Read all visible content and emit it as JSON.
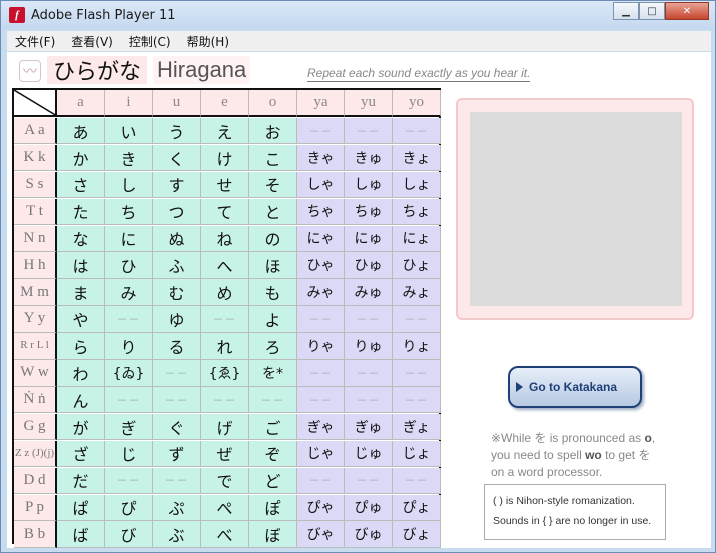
{
  "window": {
    "title": "Adobe Flash Player 11",
    "controls": [
      "minimize",
      "maximize",
      "close"
    ]
  },
  "menubar": {
    "items": [
      "文件(F)",
      "查看(V)",
      "控制(C)",
      "帮助(H)"
    ]
  },
  "header": {
    "hiragana_title": "ひらがな",
    "romaji_title": "Hiragana",
    "instruction": "Repeat each sound exactly as you hear it."
  },
  "table": {
    "columns": [
      "a",
      "i",
      "u",
      "e",
      "o",
      "ya",
      "yu",
      "yo"
    ],
    "rows": [
      {
        "label": "A a",
        "cells": [
          "あ",
          "い",
          "う",
          "え",
          "お",
          "－－",
          "－－",
          "－－"
        ]
      },
      {
        "label": "K k",
        "cells": [
          "か",
          "き",
          "く",
          "け",
          "こ",
          "きゃ",
          "きゅ",
          "きょ"
        ]
      },
      {
        "label": "S s",
        "cells": [
          "さ",
          "し",
          "す",
          "せ",
          "そ",
          "しゃ",
          "しゅ",
          "しょ"
        ]
      },
      {
        "label": "T t",
        "cells": [
          "た",
          "ち",
          "つ",
          "て",
          "と",
          "ちゃ",
          "ちゅ",
          "ちょ"
        ]
      },
      {
        "label": "N n",
        "cells": [
          "な",
          "に",
          "ぬ",
          "ね",
          "の",
          "にゃ",
          "にゅ",
          "にょ"
        ]
      },
      {
        "label": "H h",
        "cells": [
          "は",
          "ひ",
          "ふ",
          "へ",
          "ほ",
          "ひゃ",
          "ひゅ",
          "ひょ"
        ]
      },
      {
        "label": "M m",
        "cells": [
          "ま",
          "み",
          "む",
          "め",
          "も",
          "みゃ",
          "みゅ",
          "みょ"
        ]
      },
      {
        "label": "Y y",
        "cells": [
          "や",
          "－－",
          "ゆ",
          "－－",
          "よ",
          "－－",
          "－－",
          "－－"
        ]
      },
      {
        "label": "R r L l",
        "cells": [
          "ら",
          "り",
          "る",
          "れ",
          "ろ",
          "りゃ",
          "りゅ",
          "りょ"
        ]
      },
      {
        "label": "W w",
        "cells": [
          "わ",
          "{ゐ}",
          "－－",
          "{ゑ}",
          "を*",
          "－－",
          "－－",
          "－－"
        ]
      },
      {
        "label": "Ṅ ṅ",
        "cells": [
          "ん",
          "－－",
          "－－",
          "－－",
          "－－",
          "－－",
          "－－",
          "－－"
        ]
      },
      {
        "label": "G g",
        "cells": [
          "が",
          "ぎ",
          "ぐ",
          "げ",
          "ご",
          "ぎゃ",
          "ぎゅ",
          "ぎょ"
        ]
      },
      {
        "label": "Z z (J)(j)",
        "cells": [
          "ざ",
          "じ",
          "ず",
          "ぜ",
          "ぞ",
          "じゃ",
          "じゅ",
          "じょ"
        ]
      },
      {
        "label": "D d",
        "cells": [
          "だ",
          "－－",
          "－－",
          "で",
          "ど",
          "－－",
          "－－",
          "－－"
        ]
      },
      {
        "label": "P p",
        "cells": [
          "ぱ",
          "ぴ",
          "ぷ",
          "ぺ",
          "ぽ",
          "ぴゃ",
          "ぴゅ",
          "ぴょ"
        ]
      },
      {
        "label": "B b",
        "cells": [
          "ば",
          "び",
          "ぶ",
          "べ",
          "ぼ",
          "びゃ",
          "びゅ",
          "びょ"
        ]
      }
    ]
  },
  "katakana_button": {
    "label": "Go to Katakana"
  },
  "note": {
    "line1_pre": "※While ",
    "line1_kana": "を",
    "line1_mid": " is pronounced as ",
    "line1_bold": "o",
    "line1_post": ",",
    "line2_pre": "you need to spell ",
    "line2_bold": "wo",
    "line2_post": " to get を",
    "line3": "on a word processor."
  },
  "legend": {
    "line1": "(  ) is Nihon-style romanization.",
    "line2": "Sounds in { } are no longer in use."
  },
  "colors": {
    "main_cell": "#c6f2e8",
    "yoon_cell": "#dcd9f7",
    "header_pink": "#fde9ea"
  }
}
